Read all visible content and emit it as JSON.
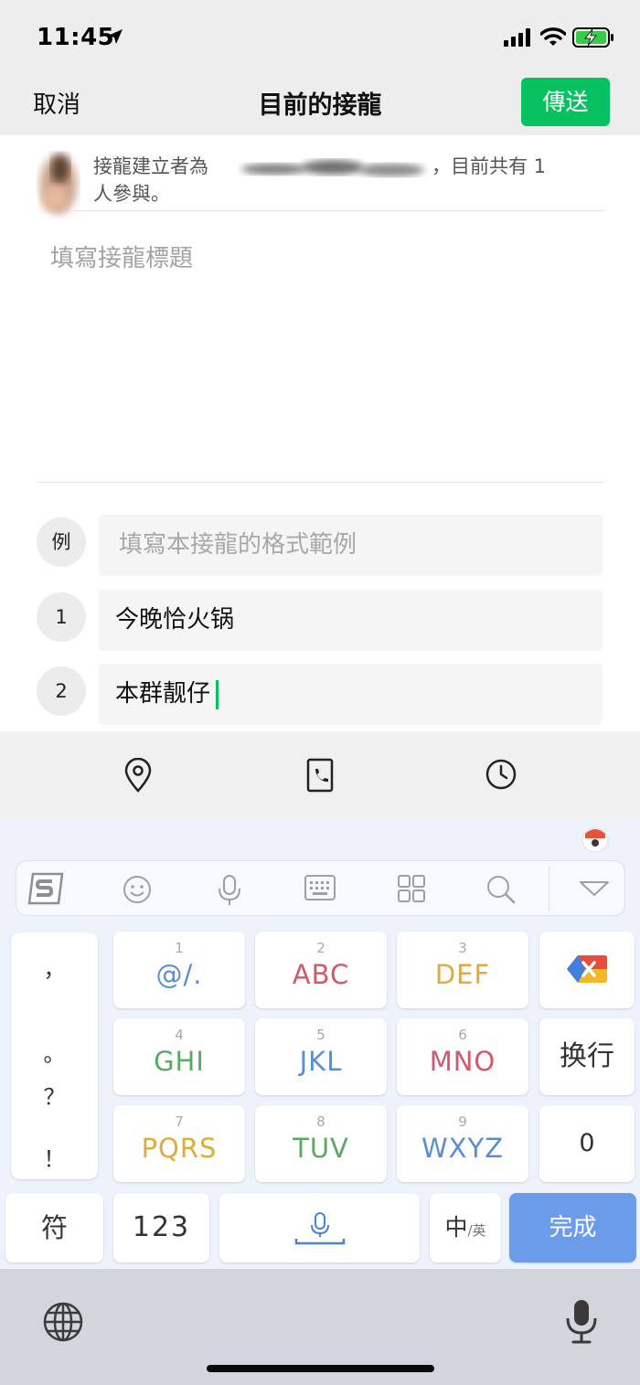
{
  "status_bar": {
    "time": "11:45",
    "icons": [
      "location-arrow-icon",
      "signal-icon",
      "wifi-icon",
      "battery-charging-icon"
    ]
  },
  "nav": {
    "cancel": "取消",
    "title": "目前的接龍",
    "send": "傳送",
    "accent": "#07c160"
  },
  "creator": {
    "prefix": "接龍建立者為",
    "suffix": "，目前共有 1",
    "line2": "人參與。"
  },
  "title_field": {
    "placeholder": "填寫接龍標題"
  },
  "entries": [
    {
      "label": "例",
      "placeholder": "填寫本接龍的格式範例",
      "value": ""
    },
    {
      "label": "1",
      "placeholder": "",
      "value": "今晚恰火锅"
    },
    {
      "label": "2",
      "placeholder": "",
      "value": "本群靓仔"
    }
  ],
  "tools": [
    "location-pin-icon",
    "phone-icon",
    "clock-icon"
  ],
  "keyboard": {
    "candidate_icons": [
      "sogou-logo-icon",
      "emoji-icon",
      "microphone-icon",
      "keyboard-icon",
      "apps-grid-icon",
      "search-icon",
      "collapse-chevron-icon"
    ],
    "punctuation": [
      "，",
      "。",
      "？",
      "！"
    ],
    "keys": [
      {
        "digit": "1",
        "letters": "@/.",
        "color": "#5b8ed1"
      },
      {
        "digit": "2",
        "letters": "ABC",
        "color": "#d2576d"
      },
      {
        "digit": "3",
        "letters": "DEF",
        "color": "#e0ab3d"
      },
      {
        "digit": "4",
        "letters": "GHI",
        "color": "#5aa864"
      },
      {
        "digit": "5",
        "letters": "JKL",
        "color": "#5b8ed1"
      },
      {
        "digit": "6",
        "letters": "MNO",
        "color": "#d2576d"
      },
      {
        "digit": "7",
        "letters": "PQRS",
        "color": "#e0ab3d"
      },
      {
        "digit": "8",
        "letters": "TUV",
        "color": "#5aa864"
      },
      {
        "digit": "9",
        "letters": "WXYZ",
        "color": "#5b8ed1"
      }
    ],
    "newline": "换行",
    "zero": "0",
    "symbols": "符",
    "numbers": "123",
    "lang_main": "中",
    "lang_sub": "/英",
    "done": "完成",
    "done_color": "#6b9cec"
  },
  "system_bar": {
    "icons": [
      "globe-icon",
      "dictation-microphone-icon"
    ]
  }
}
